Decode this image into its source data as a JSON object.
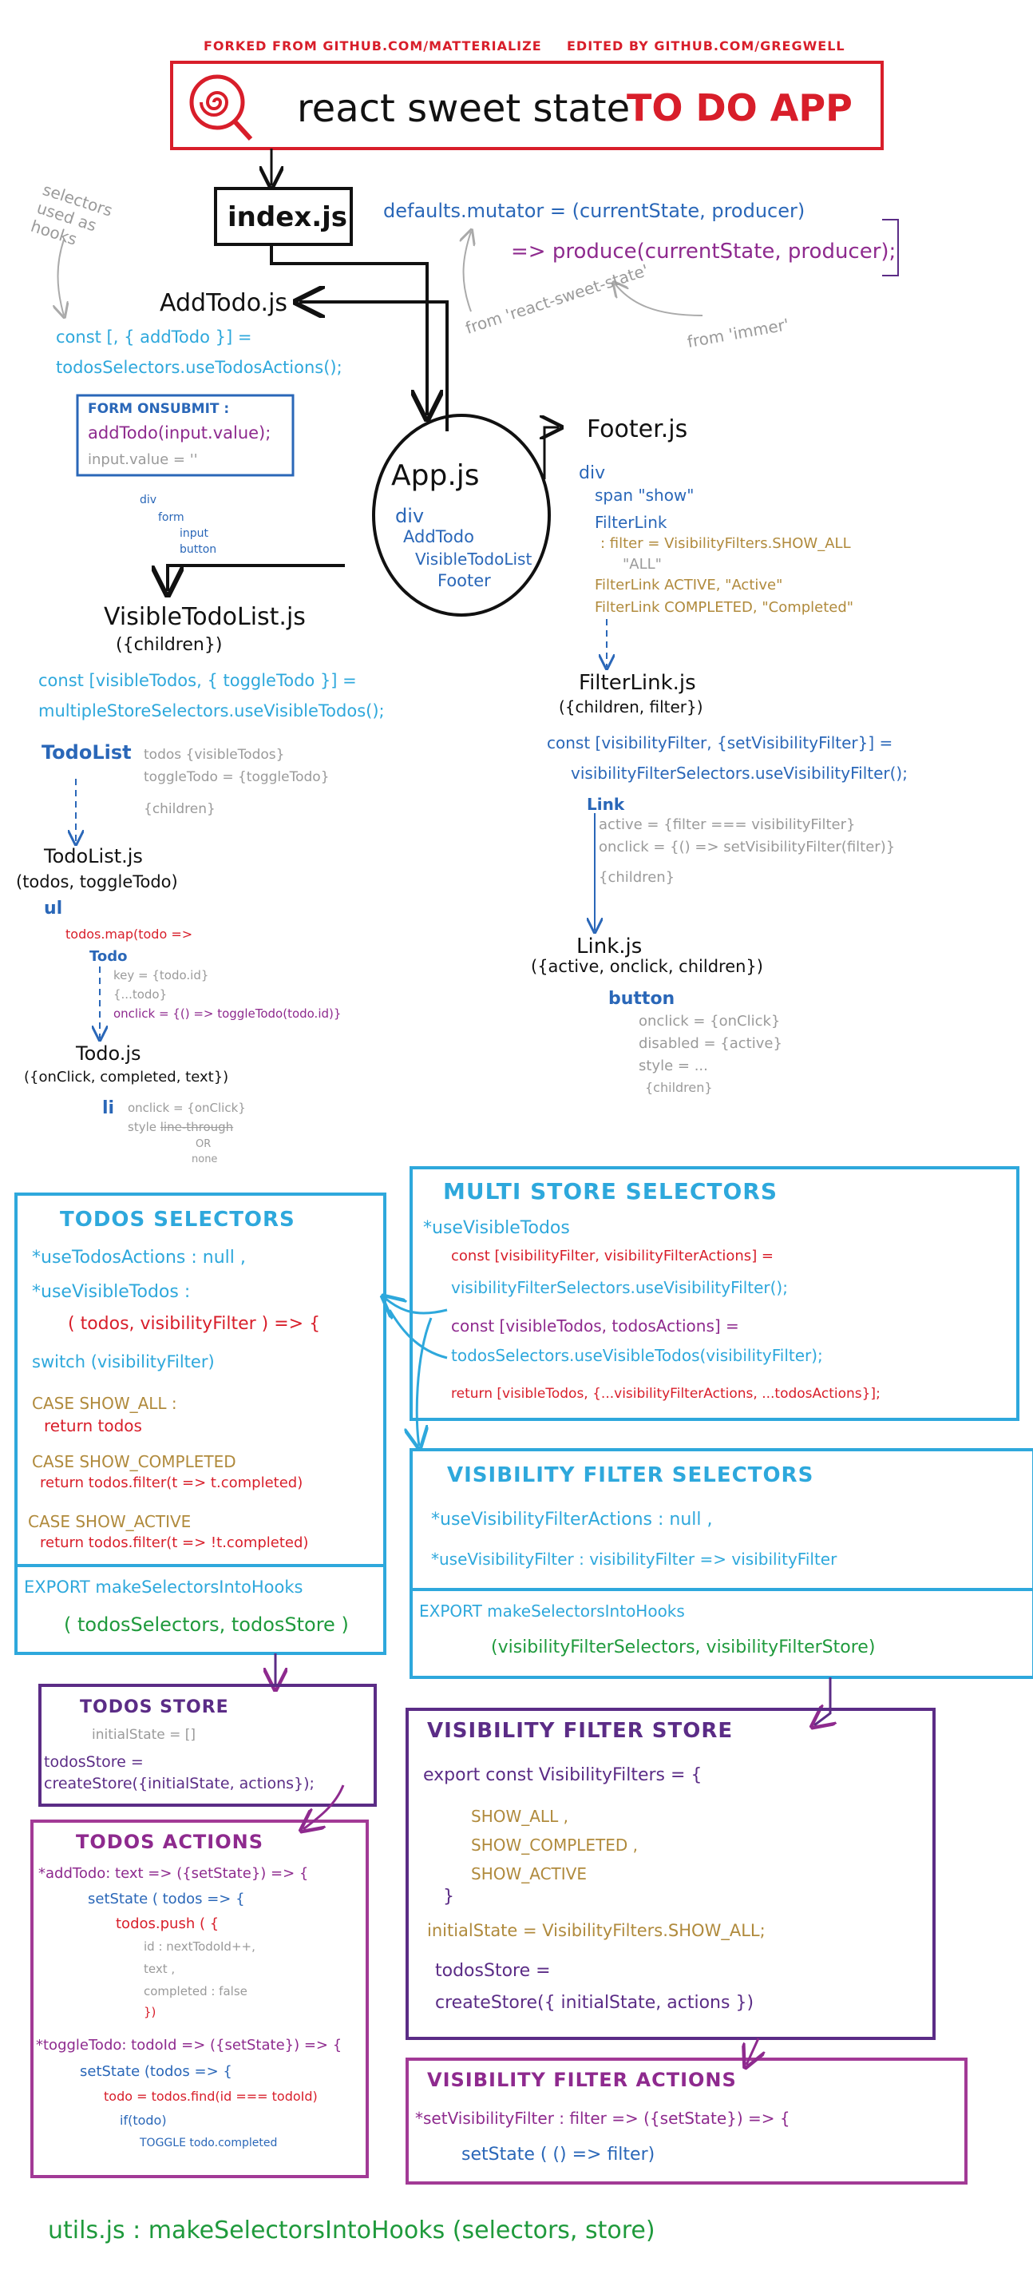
{
  "header": {
    "forked": "FORKED FROM GITHUB.COM/MATTERIALIZE",
    "edited": "EDITED BY GITHUB.COM/GREGWELL",
    "title_part1": "react sweet state",
    "title_part2": "TO DO APP"
  },
  "index": {
    "label": "index.js",
    "side_note": "selectors used as hooks",
    "defaults_line1": "defaults.mutator = (currentState, producer)",
    "defaults_line2": "=> produce(currentState, producer);",
    "note_sweet": "from 'react-sweet-state'",
    "note_immer": "from 'immer'"
  },
  "addtodo": {
    "label": "AddTodo.js",
    "line1": "const [, { addTodo }] =",
    "line2": "todosSelectors.useTodosActions();",
    "form_title": "FORM ONSUBMIT :",
    "form_line1": "addTodo(input.value);",
    "form_line2": "input.value = ''",
    "tree": [
      "div",
      "form",
      "input",
      "button"
    ]
  },
  "app": {
    "label": "App.js",
    "items": [
      "div",
      "AddTodo",
      "VisibleTodoList",
      "Footer"
    ]
  },
  "footer": {
    "label": "Footer.js",
    "div": "div",
    "span": "span \"show\"",
    "filterlink": "FilterLink",
    "filter_line": ": filter = VisibilityFilters.SHOW_ALL",
    "all": "\"ALL\"",
    "active_line": "FilterLink  ACTIVE, \"Active\"",
    "completed_line": "FilterLink  COMPLETED, \"Completed\""
  },
  "filterlink": {
    "label": "FilterLink.js",
    "props": "({children, filter})",
    "line1": "const [visibilityFilter, {setVisibilityFilter}] =",
    "line2": "visibilityFilterSelectors.useVisibilityFilter();",
    "link": "Link",
    "active": "active = {filter === visibilityFilter}",
    "onclick": "onclick = {() => setVisibilityFilter(filter)}",
    "children": "{children}"
  },
  "link": {
    "label": "Link.js",
    "props": "({active, onclick, children})",
    "button": "button",
    "onclick": "onclick = {onClick}",
    "disabled": "disabled = {active}",
    "style": "style = ...",
    "children": "{children}"
  },
  "visibletodolist": {
    "label": "VisibleTodoList.js",
    "props": "({children})",
    "line1": "const [visibleTodos, { toggleTodo }] =",
    "line2": "multipleStoreSelectors.useVisibleTodos();",
    "todolist": "TodoList",
    "todos": "todos {visibleTodos}",
    "toggle": "toggleTodo = {toggleTodo}",
    "children": "{children}"
  },
  "todolistjs": {
    "label": "TodoList.js",
    "props": "(todos, toggleTodo)",
    "ul": "ul",
    "map": "todos.map(todo =>",
    "todo": "Todo",
    "key": "key = {todo.id}",
    "spread": "{...todo}",
    "onclick": "onclick = {() => toggleTodo(todo.id)}"
  },
  "todojs": {
    "label": "Todo.js",
    "props": "({onClick, completed, text})",
    "li": "li",
    "onclick": "onclick = {onClick}",
    "style": "style ",
    "strike": "line-through",
    "or": "OR",
    "none": "none"
  },
  "todos_selectors": {
    "title": "TODOS SELECTORS",
    "actions": "*useTodosActions : null ,",
    "visible": "*useVisibleTodos :",
    "params": "( todos, visibilityFilter ) => {",
    "switch": "switch (visibilityFilter)",
    "case_all": "CASE  SHOW_ALL :",
    "ret_all": "return  todos",
    "case_completed": "CASE  SHOW_COMPLETED",
    "ret_completed": "return todos.filter(t => t.completed)",
    "case_active": "CASE  SHOW_ACTIVE",
    "ret_active": "return todos.filter(t => !t.completed)",
    "export": "EXPORT makeSelectorsIntoHooks",
    "export_args": "( todosSelectors, todosStore )"
  },
  "multi_selectors": {
    "title": "MULTI STORE  SELECTORS",
    "fn": "*useVisibleTodos",
    "line1": "const [visibilityFilter, visibilityFilterActions] =",
    "line2": "visibilityFilterSelectors.useVisibilityFilter();",
    "line3": "const [visibleTodos, todosActions] =",
    "line4": "todosSelectors.useVisibleTodos(visibilityFilter);",
    "line5": "return [visibleTodos, {...visibilityFilterActions, ...todosActions}];"
  },
  "vf_selectors": {
    "title": "VISIBILITY FILTER SELECTORS",
    "actions": "*useVisibilityFilterActions : null ,",
    "filter": "*useVisibilityFilter :  visibilityFilter => visibilityFilter",
    "export": "EXPORT makeSelectorsIntoHooks",
    "export_args": "(visibilityFilterSelectors, visibilityFilterStore)"
  },
  "todos_store": {
    "title": "TODOS STORE",
    "initial": "initialState = []",
    "line1": "todosStore =",
    "line2": "createStore({initialState, actions});"
  },
  "todos_actions": {
    "title": "TODOS ACTIONS",
    "add": "*addTodo:  text => ({setState}) => {",
    "setstate": "setState ( todos => {",
    "push": "todos.push ( {",
    "id": "id : nextTodoId++,",
    "text": "text ,",
    "completed": "completed : false",
    "close": "})",
    "toggle": "*toggleTodo:  todoId => ({setState}) => {",
    "setstate2": "setState (todos => {",
    "find": "todo = todos.find(id === todoId)",
    "if": "if(todo)",
    "togglecomp": "TOGGLE  todo.completed"
  },
  "vf_store": {
    "title": "VISIBILITY FILTER STORE",
    "export": "export const VisibilityFilters = {",
    "items": [
      "SHOW_ALL ,",
      "SHOW_COMPLETED ,",
      "SHOW_ACTIVE"
    ],
    "close": "}",
    "initial": "initialState = VisibilityFilters.SHOW_ALL;",
    "store1": "todosStore =",
    "store2": "createStore({ initialState, actions })"
  },
  "vf_actions": {
    "title": "VISIBILITY FILTER ACTIONS",
    "line1": "*setVisibilityFilter :  filter => ({setState}) => {",
    "line2": "setState ( () => filter)"
  },
  "utils": {
    "text": "utils.js : makeSelectorsIntoHooks (selectors, store)"
  },
  "colors": {
    "red": "#d81e2a",
    "blue": "#2a67b8",
    "light_blue": "#2ea8dc",
    "purple": "#8e2a8e",
    "dark_purple": "#5b2c86",
    "gold": "#b08a3c",
    "gray": "#9a9a9a",
    "green": "#1f9a3c"
  },
  "icons": {
    "logo": "spiral-magnifier-icon"
  }
}
